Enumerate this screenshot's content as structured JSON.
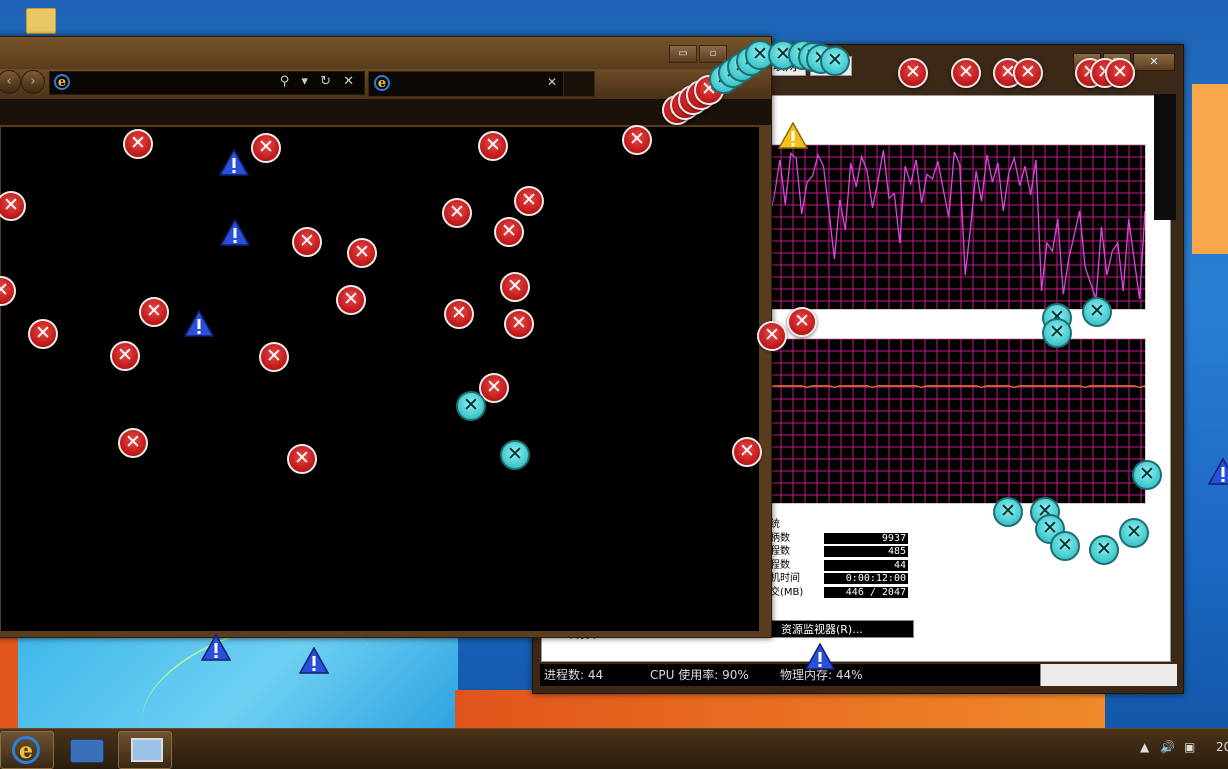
{
  "desktop": {
    "folder_icon": "folder-icon"
  },
  "browser": {
    "window_buttons": [
      "▭",
      "▫"
    ],
    "address_value": "",
    "addr_tools": "⚲ ▾ ↻ ✕",
    "tab_title": "",
    "tab_close": "✕"
  },
  "task_manager": {
    "window_buttons": [
      "—",
      "▢",
      "✕"
    ],
    "tabs": [
      "联网",
      "用户"
    ],
    "stats_title": "统",
    "stats": [
      {
        "label": "柄数",
        "value": "9937"
      },
      {
        "label": "程数",
        "value": "485"
      },
      {
        "label": "程数",
        "value": "44"
      },
      {
        "label": "机时间",
        "value": "0:00:12:00"
      },
      {
        "label": "交(MB)",
        "value": "446 / 2047"
      }
    ],
    "partial_label": "末分页",
    "resource_monitor_button": "资源监视器(R)...",
    "status": {
      "processes": "进程数: 44",
      "cpu": "CPU 使用率: 90%",
      "memory": "物理内存: 44%"
    },
    "cpu_history": [
      55,
      70,
      92,
      64,
      96,
      93,
      58,
      78,
      82,
      95,
      88,
      60,
      30,
      67,
      48,
      90,
      75,
      94,
      85,
      62,
      79,
      98,
      68,
      71,
      40,
      88,
      77,
      92,
      65,
      83,
      80,
      91,
      73,
      56,
      97,
      89,
      20,
      50,
      85,
      66,
      95,
      78,
      90,
      60,
      84,
      93,
      76,
      88,
      70,
      92,
      10,
      40,
      35,
      55,
      8,
      30,
      45,
      60,
      25,
      15,
      5,
      50,
      20,
      35,
      40,
      10,
      55,
      30,
      5,
      60
    ],
    "memory_history": [
      72,
      72,
      72,
      72,
      72,
      72,
      72,
      71,
      72,
      72,
      72,
      72,
      71,
      72,
      72,
      72,
      72,
      72,
      72,
      71,
      72,
      72,
      72,
      72,
      72,
      72,
      72,
      72,
      71,
      72,
      72,
      72,
      72,
      72,
      72,
      72,
      72,
      72,
      72,
      71,
      72,
      72,
      72,
      72,
      72,
      71,
      72,
      72,
      72,
      72,
      72,
      72,
      72,
      72,
      72,
      72,
      72,
      72,
      71,
      72,
      72,
      72,
      72,
      72,
      72,
      72,
      72,
      72,
      71,
      72
    ]
  },
  "taskbar": {
    "items": [
      "ie-icon",
      "printer-fax-icon",
      "monitor-icon"
    ],
    "tray_time": "20"
  },
  "colors": {
    "window_frame": "#5a3d1f",
    "graph_grid": "#c21c8a",
    "cpu_line": "#d94ad9",
    "mem_line": "#e07a1a",
    "error_red": "#c21a1a",
    "x_cyan": "#3fc7cc",
    "warn_blue": "#2a4fd8"
  }
}
